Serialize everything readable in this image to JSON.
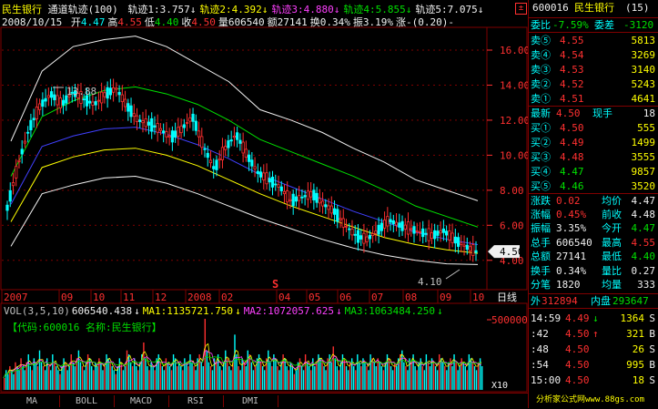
{
  "stock": {
    "name": "民生银行",
    "indicator": "通道轨迹(100)",
    "date": "2008/10/15",
    "code": "600016",
    "period_no": "(15)"
  },
  "tracks": [
    {
      "label": "轨迹1:",
      "value": "3.757",
      "color": "#f0f0f0"
    },
    {
      "label": "轨迹2:",
      "value": "4.392",
      "color": "#ffff00"
    },
    {
      "label": "轨迹3:",
      "value": "4.880",
      "color": "#ff40ff"
    },
    {
      "label": "轨迹4:",
      "value": "5.855",
      "color": "#00e000"
    },
    {
      "label": "轨迹5:",
      "value": "7.075",
      "color": "#f0f0f0"
    }
  ],
  "quote_line": [
    {
      "label": "开",
      "value": "4.47",
      "color": "#00ffff"
    },
    {
      "label": "高",
      "value": "4.55",
      "color": "#ff3030"
    },
    {
      "label": "低",
      "value": "4.40",
      "color": "#00e000"
    },
    {
      "label": "收",
      "value": "4.50",
      "color": "#ff3030"
    },
    {
      "label": "量",
      "value": "606540",
      "color": "#f0f0f0"
    },
    {
      "label": "额",
      "value": "27141",
      "color": "#f0f0f0"
    },
    {
      "label": "换",
      "value": "0.34%",
      "color": "#f0f0f0"
    },
    {
      "label": "振",
      "value": "3.19%",
      "color": "#f0f0f0"
    },
    {
      "label": "涨",
      "value": "-(0.20)-",
      "color": "#f0f0f0"
    }
  ],
  "chart_data": {
    "type": "candlestick",
    "price_axis": [
      "16.00",
      "14.00",
      "12.00",
      "10.00",
      "8.00",
      "6.00",
      "4.00"
    ],
    "ylim": [
      3.0,
      17.3
    ],
    "current_price_tag": "4.50",
    "high_annotation": "13.88",
    "low_annotation": "4.10",
    "x_labels": [
      "2007",
      "09",
      "10",
      "11",
      "12",
      "2008",
      "02",
      "04",
      "05",
      "06",
      "07",
      "08",
      "09",
      "10"
    ],
    "period_label": "日线",
    "event_marker": "S",
    "price_path": [
      7.0,
      9.5,
      11.5,
      12.8,
      13.5,
      12.9,
      13.6,
      13.2,
      12.9,
      13.5,
      13.8,
      12.8,
      12.0,
      11.8,
      11.5,
      11.0,
      11.5,
      12.2,
      10.5,
      9.2,
      10.4,
      11.2,
      10.0,
      9.0,
      8.6,
      8.2,
      7.4,
      7.6,
      7.8,
      7.2,
      6.8,
      6.0,
      5.4,
      5.2,
      5.7,
      6.3,
      6.0,
      5.8,
      5.6,
      5.4,
      5.7,
      5.2,
      4.8,
      4.5
    ],
    "bands": [
      {
        "name": "轨迹5",
        "color": "#f0f0f0",
        "values": [
          10.8,
          14.8,
          16.2,
          16.6,
          16.8,
          16.2,
          15.2,
          14.2,
          12.6,
          12.0,
          11.3,
          10.4,
          9.6,
          8.6,
          8.0,
          7.4
        ]
      },
      {
        "name": "轨迹4",
        "color": "#00e000",
        "values": [
          8.8,
          12.2,
          13.1,
          13.7,
          13.9,
          13.5,
          12.9,
          12.0,
          10.9,
          10.2,
          9.5,
          8.8,
          8.0,
          7.1,
          6.5,
          5.9
        ]
      },
      {
        "name": "轨迹3",
        "color": "#4040ff",
        "values": [
          7.2,
          10.5,
          11.1,
          11.5,
          11.6,
          11.2,
          10.6,
          9.8,
          8.9,
          8.2,
          7.5,
          6.8,
          6.2,
          5.6,
          5.2,
          4.9
        ]
      },
      {
        "name": "轨迹2",
        "color": "#ffff00",
        "values": [
          6.2,
          9.3,
          9.9,
          10.3,
          10.4,
          10.0,
          9.4,
          8.6,
          7.8,
          7.1,
          6.5,
          5.9,
          5.3,
          4.9,
          4.6,
          4.4
        ]
      },
      {
        "name": "轨迹1",
        "color": "#f0f0f0",
        "values": [
          4.8,
          7.8,
          8.3,
          8.7,
          8.8,
          8.4,
          7.8,
          7.1,
          6.4,
          5.8,
          5.2,
          4.7,
          4.3,
          4.0,
          3.8,
          3.76
        ]
      }
    ]
  },
  "volume": {
    "header": [
      {
        "text": "VOL(3,5,10)",
        "color": "#c0c0c0"
      },
      {
        "text": "606540.438",
        "color": "#f0f0f0"
      },
      {
        "text": "MA1:1135721.750",
        "color": "#ffff00"
      },
      {
        "text": "MA2:1072057.625",
        "color": "#ff40ff"
      },
      {
        "text": "MA3:1063484.250",
        "color": "#00e000"
      }
    ],
    "overlay_label": "【代码:600016 名称:民生银行】",
    "axis_top": "500000",
    "axis_unit": "X10",
    "bars": [
      3,
      5,
      4,
      6,
      5,
      4,
      7,
      6,
      5,
      8,
      6,
      5,
      7,
      9,
      6,
      5,
      8,
      7,
      6,
      10,
      7,
      6,
      5,
      8,
      6,
      5,
      9,
      7,
      6,
      5,
      4,
      6,
      8,
      7,
      5,
      6,
      9,
      7,
      6,
      8,
      10,
      7,
      6,
      5,
      7,
      9,
      8,
      6,
      5,
      7,
      6,
      8,
      7,
      5,
      6,
      9,
      8,
      7,
      6,
      5,
      4,
      6,
      8,
      7,
      5,
      6,
      10,
      9,
      7,
      6,
      8,
      6,
      5,
      7,
      9,
      12,
      8,
      6,
      5,
      7,
      6,
      5,
      8,
      9,
      7,
      6,
      5,
      8,
      7,
      6,
      5,
      9,
      8,
      6,
      7,
      6,
      5,
      8,
      7,
      6,
      9,
      7,
      6,
      5,
      8,
      9,
      7,
      6,
      18,
      10,
      7,
      6,
      5,
      8,
      7,
      9,
      6,
      5,
      7,
      10,
      8,
      6,
      5,
      7,
      14,
      9,
      6,
      5,
      8,
      7,
      6,
      10,
      9,
      7,
      5,
      6,
      8,
      9,
      7,
      6,
      5,
      8,
      10,
      7,
      6,
      9,
      8,
      6,
      5,
      7,
      9,
      8,
      6,
      5,
      7,
      6,
      4,
      5,
      7,
      8,
      6,
      5,
      9,
      7,
      6,
      5,
      8,
      6,
      7,
      9,
      8,
      7,
      6,
      5,
      8,
      9,
      7,
      11,
      8,
      6,
      5,
      7,
      9,
      8,
      6,
      5,
      7,
      8,
      6,
      5,
      9,
      7,
      6,
      8,
      7,
      6,
      5,
      9,
      8,
      7,
      6,
      8,
      7,
      6,
      5,
      7,
      9,
      8,
      6,
      5,
      7,
      6,
      8,
      9,
      10,
      7,
      6,
      5,
      8,
      7,
      9,
      6,
      5,
      7,
      8,
      6,
      5,
      9,
      7,
      6,
      8,
      7,
      6,
      5,
      9,
      8,
      7,
      6,
      5,
      7,
      8,
      6,
      9,
      7,
      5,
      6,
      8,
      7,
      6,
      5,
      9,
      8,
      7,
      6,
      5,
      7,
      8,
      6
    ]
  },
  "tabs": [
    "MA",
    "BOLL",
    "MACD",
    "RSI",
    "DMI"
  ],
  "side": {
    "code": "600016",
    "name": "民生银行",
    "period": "(15)",
    "weibi_label": "委比",
    "weibi_value": "-7.59%",
    "weicha_label": "委差",
    "weicha_value": "-3120",
    "sells": [
      {
        "label": "卖⑤",
        "price": "4.55",
        "vol": "5813"
      },
      {
        "label": "卖④",
        "price": "4.54",
        "vol": "3269"
      },
      {
        "label": "卖③",
        "price": "4.53",
        "vol": "3140"
      },
      {
        "label": "卖②",
        "price": "4.52",
        "vol": "5243"
      },
      {
        "label": "卖①",
        "price": "4.51",
        "vol": "4641"
      }
    ],
    "latest_label": "最新",
    "latest_value": "4.50",
    "xianshou_label": "现手",
    "xianshou_value": "18",
    "buys": [
      {
        "label": "买①",
        "price": "4.50",
        "vol": "555"
      },
      {
        "label": "买②",
        "price": "4.49",
        "vol": "1499"
      },
      {
        "label": "买③",
        "price": "4.48",
        "vol": "3555"
      },
      {
        "label": "买④",
        "price": "4.47",
        "vol": "9857"
      },
      {
        "label": "买⑤",
        "price": "4.46",
        "vol": "3520"
      }
    ],
    "stats": [
      {
        "l1": "涨跌",
        "v1": "0.02",
        "c1": "#ff3030",
        "l2": "均价",
        "v2": "4.47",
        "c2": "#f0f0f0"
      },
      {
        "l1": "涨幅",
        "v1": "0.45%",
        "c1": "#ff3030",
        "l2": "前收",
        "v2": "4.48",
        "c2": "#f0f0f0"
      },
      {
        "l1": "振幅",
        "v1": "3.35%",
        "c1": "#f0f0f0",
        "l2": "今开",
        "v2": "4.47",
        "c2": "#00e000"
      },
      {
        "l1": "总手",
        "v1": "606540",
        "c1": "#f0f0f0",
        "l2": "最高",
        "v2": "4.55",
        "c2": "#ff3030"
      },
      {
        "l1": "总额",
        "v1": "27141",
        "c1": "#f0f0f0",
        "l2": "最低",
        "v2": "4.40",
        "c2": "#00e000"
      },
      {
        "l1": "换手",
        "v1": "0.34%",
        "c1": "#f0f0f0",
        "l2": "量比",
        "v2": "0.27",
        "c2": "#f0f0f0"
      },
      {
        "l1": "分笔",
        "v1": "1820",
        "c1": "#f0f0f0",
        "l2": "均量",
        "v2": "333",
        "c2": "#f0f0f0"
      }
    ],
    "waipan_label": "外",
    "waipan_value": "312894",
    "neipan_label": "内盘",
    "neipan_value": "293647",
    "ticks": [
      {
        "time": "14:59",
        "price": "4.49",
        "arrow": "↓",
        "vol": "1364",
        "bs": "S"
      },
      {
        "time": ":42",
        "price": "4.50",
        "arrow": "↑",
        "vol": "321",
        "bs": "B"
      },
      {
        "time": ":48",
        "price": "4.50",
        "arrow": "",
        "vol": "26",
        "bs": "S"
      },
      {
        "time": ":54",
        "price": "4.50",
        "arrow": "",
        "vol": "995",
        "bs": "B"
      },
      {
        "time": "15:00",
        "price": "4.50",
        "arrow": "",
        "vol": "18",
        "bs": "S"
      }
    ],
    "footer": "分析家公式网www.88gs.com"
  }
}
